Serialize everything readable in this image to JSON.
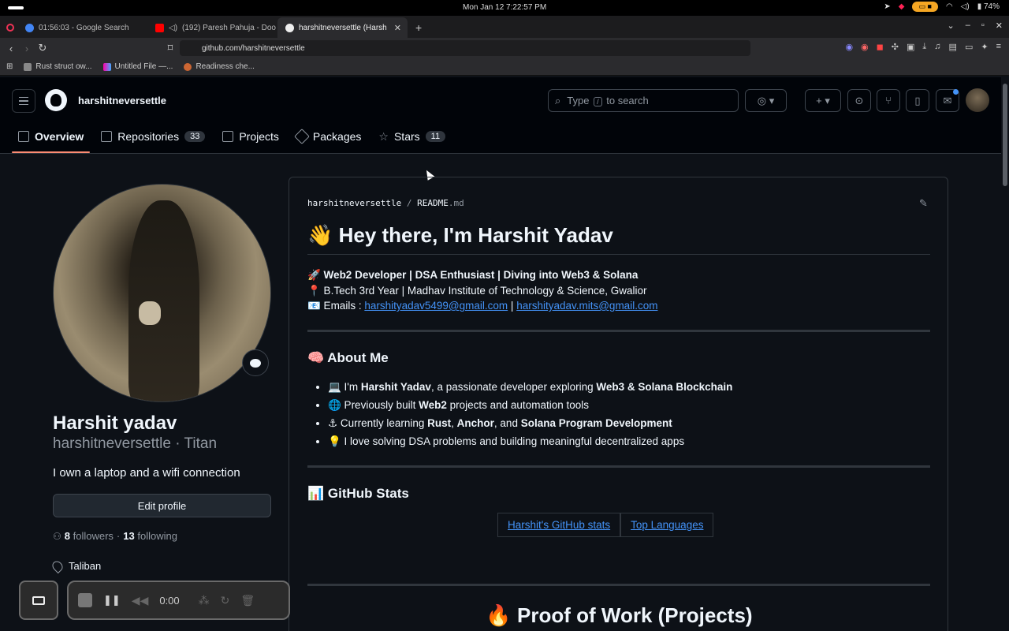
{
  "os": {
    "clock": "Mon Jan 12   7:22:57 PM",
    "battery": "74%"
  },
  "browser": {
    "tabs": [
      {
        "title": "01:56:03 - Google Search",
        "active": false
      },
      {
        "title": "(192) Paresh Pahuja - Doo",
        "active": false
      },
      {
        "title": "harshitneversettle (Harsh",
        "active": true
      }
    ],
    "url": "github.com/harshitneversettle",
    "bookmarks": [
      "Rust struct ow...",
      "Untitled File —...",
      "Readiness che..."
    ]
  },
  "github": {
    "header_username": "harshitneversettle",
    "search": {
      "prefix": "Type",
      "key": "/",
      "suffix": "to search"
    },
    "nav": [
      {
        "label": "Overview",
        "count": "",
        "icon": "book-icon"
      },
      {
        "label": "Repositories",
        "count": "33",
        "icon": "repo-icon"
      },
      {
        "label": "Projects",
        "count": "",
        "icon": "table-icon"
      },
      {
        "label": "Packages",
        "count": "",
        "icon": "package-icon"
      },
      {
        "label": "Stars",
        "count": "11",
        "icon": "star-icon"
      }
    ]
  },
  "profile": {
    "name": "Harshit yadav",
    "login_line": "harshitneversettle · Titan",
    "bio": "I own a laptop and a wifi connection",
    "edit_label": "Edit profile",
    "followers": "8",
    "followers_label": "followers",
    "following": "13",
    "following_label": "following",
    "location": "Taliban"
  },
  "readme": {
    "path_user": "harshitneversettle",
    "path_file": "README",
    "path_ext": ".md",
    "title": "👋 Hey there, I'm Harshit Yadav",
    "line1": "🚀 Web2 Developer | DSA Enthusiast | Diving into Web3 & Solana",
    "line2": "📍 B.Tech 3rd Year | Madhav Institute of Technology & Science, Gwalior",
    "emails_label": "📧 Emails :",
    "email1": "harshityadav5499@gmail.com",
    "email_sep": "|",
    "email2": "harshityadav.mits@gmail.com",
    "about_heading": "🧠 About Me",
    "about": [
      {
        "pre": "💻 I'm ",
        "b1": "Harshit Yadav",
        "mid": ", a passionate developer exploring ",
        "b2": "Web3 & Solana Blockchain",
        "post": ""
      },
      {
        "pre": "🌐 Previously built ",
        "b1": "Web2",
        "mid": " projects and automation tools",
        "b2": "",
        "post": ""
      },
      {
        "pre": "⚓ Currently learning ",
        "b1": "Rust",
        "mid": ", ",
        "b2": "Anchor",
        "post": ", and ",
        "b3": "Solana Program Development"
      },
      {
        "pre": "💡 I love solving DSA problems and building meaningful decentralized apps",
        "b1": "",
        "mid": "",
        "b2": "",
        "post": ""
      }
    ],
    "stats_heading": "📊 GitHub Stats",
    "stats_img1": "Harshit's GitHub stats",
    "stats_img2": "Top Languages",
    "proof_heading": "🔥 Proof of Work (Projects)"
  },
  "recorder": {
    "time": "0:00"
  }
}
